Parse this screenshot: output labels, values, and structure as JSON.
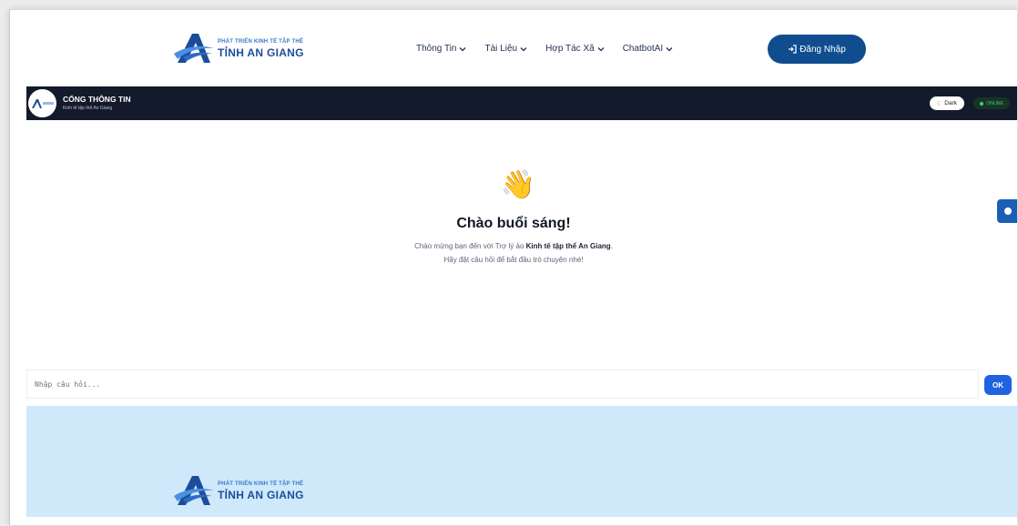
{
  "brand": {
    "small_text": "PHÁT TRIỂN KINH TẾ TẬP THỂ",
    "big_text": "TỈNH AN GIANG"
  },
  "nav": {
    "items": [
      {
        "label": "Thông Tin"
      },
      {
        "label": "Tài Liệu"
      },
      {
        "label": "Hợp Tác Xã"
      },
      {
        "label": "ChatbotAI"
      }
    ],
    "login_label": "Đăng Nhập"
  },
  "portal": {
    "title": "CỔNG THÔNG TIN",
    "subtitle": "Kinh tế tập thể An Giang",
    "dark_label": "Dark",
    "status_label": "ONLINE"
  },
  "welcome": {
    "emoji": "👋",
    "greeting": "Chào buổi sáng!",
    "line1_prefix": "Chào mừng bạn đến với Trợ lý ảo ",
    "line1_bold": "Kinh tế tập thể An Giang",
    "line1_suffix": ".",
    "line2": "Hãy đặt câu hỏi để bắt đầu trò chuyện nhé!"
  },
  "chat": {
    "placeholder": "Nhập câu hỏi...",
    "value": "",
    "send_label": "OK"
  },
  "colors": {
    "primary_button": "#0f4d8f",
    "header_bar": "#131a2b",
    "send_button": "#1f63e0",
    "footer_bg": "#cfe9fb",
    "online": "#3ecf7c"
  },
  "icons": {
    "chevron": "chevron-down-icon",
    "login": "login-icon",
    "moon": "moon-icon",
    "logo": "an-giang-logo-icon"
  }
}
